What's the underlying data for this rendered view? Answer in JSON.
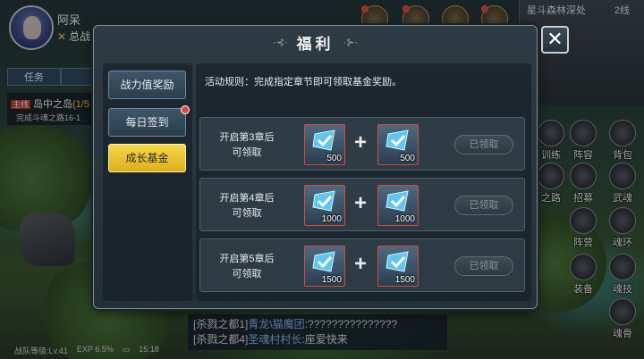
{
  "player": {
    "name": "阿呆",
    "power_label": "总战"
  },
  "map": {
    "title": "星斗森林深处",
    "line": "2线"
  },
  "task": {
    "tabs": [
      "任务",
      ""
    ],
    "tag": "主线",
    "title": "岛中之岛",
    "progress": "(1/5",
    "subtitle": "完成斗魂之路16-1"
  },
  "side_menu": [
    "训练",
    "阵容",
    "背包",
    "之路",
    "招募",
    "武魂",
    "阵营",
    "魂环",
    "装备",
    "魂技",
    "魂骨"
  ],
  "chat": [
    {
      "channel": "[杀戮之都1]",
      "name": "青龙\\猫魔团",
      "text": ":???????????????"
    },
    {
      "channel": "[杀戮之都4]",
      "name": "圣魂村村长",
      "text": ":座爱快来"
    }
  ],
  "status": {
    "level": "战队等级:Lv.41",
    "exp": "EXP 6.5%",
    "time": "15:18"
  },
  "modal": {
    "title": "福利",
    "close_glyph": "✕",
    "nav": [
      {
        "label": "战力值奖励",
        "active": false,
        "badge": false
      },
      {
        "label": "每日签到",
        "active": false,
        "badge": true
      },
      {
        "label": "成长基金",
        "active": true,
        "badge": false
      }
    ],
    "rules": "活动规则：完成指定章节即可领取基金奖励。",
    "rows": [
      {
        "line1": "开启第3章后",
        "line2": "可领取",
        "qty_a": "500",
        "qty_b": "500",
        "status": "已领取"
      },
      {
        "line1": "开启第4章后",
        "line2": "可领取",
        "qty_a": "1000",
        "qty_b": "1000",
        "status": "已领取"
      },
      {
        "line1": "开启第5章后",
        "line2": "可领取",
        "qty_a": "1500",
        "qty_b": "1500",
        "status": "已领取"
      }
    ],
    "plus_glyph": "+",
    "reward_icon": "blue-crystal-check-icon"
  }
}
